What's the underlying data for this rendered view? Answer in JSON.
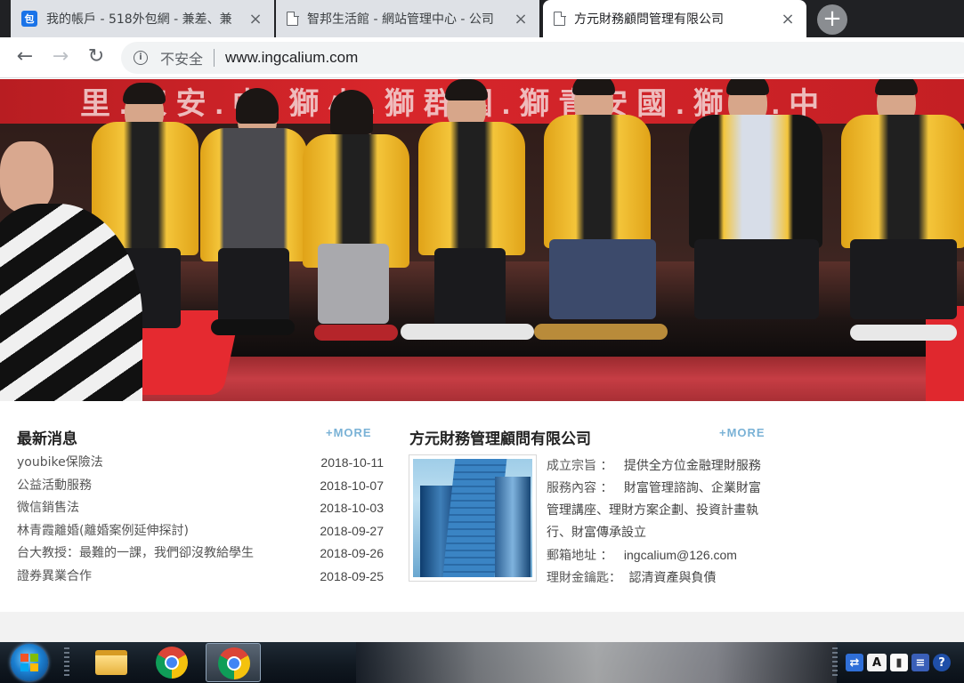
{
  "browser": {
    "tabs": [
      {
        "title": "我的帳戶 - 518外包網 - 兼差、兼",
        "favicon": "518-favicon-icon",
        "active": false
      },
      {
        "title": "智邦生活館 - 網站管理中心 - 公司",
        "favicon": "document-icon",
        "active": false
      },
      {
        "title": "方元財務顧問管理有限公司",
        "favicon": "document-icon",
        "active": true
      }
    ],
    "favicon_label": "包",
    "new_tab_label": "+",
    "toolbar": {
      "back": "←",
      "forward": "→",
      "reload": "↻",
      "security_text": "不安全",
      "url": "www.ingcalium.com"
    }
  },
  "banner": {
    "sign_text": "里.家安.中.獅小.獅群園.獅青安國.獅潭.中"
  },
  "news": {
    "title": "最新消息",
    "more_label": "+MORE",
    "items": [
      {
        "title": "youbike保險法",
        "date": "2018-10-11"
      },
      {
        "title": "公益活動服務",
        "date": "2018-10-07"
      },
      {
        "title": "微信銷售法",
        "date": "2018-10-03"
      },
      {
        "title": "林青霞離婚(離婚案例延伸探討)",
        "date": "2018-09-27"
      },
      {
        "title": "台大教授：最難的一課，我們卻沒教給學生",
        "date": "2018-09-26"
      },
      {
        "title": "證券異業合作",
        "date": "2018-09-25"
      }
    ]
  },
  "company": {
    "title": "方元財務管理顧問有限公司",
    "more_label": "+MORE",
    "info_lines": [
      {
        "label": "成立宗旨 ：",
        "value": "提供全方位金融理財服務"
      },
      {
        "label": "服務內容 ：",
        "value": "財富管理諮詢、企業財富"
      },
      {
        "label": "",
        "value": "管理講座、理財方案企劃、投資計畫執"
      },
      {
        "label": "",
        "value": "行、財富傳承設立"
      },
      {
        "label": "郵箱地址 ：",
        "value": "ingcalium@126.com"
      },
      {
        "label": "理財金鑰匙：",
        "value": "認清資產與負債"
      }
    ]
  },
  "taskbar": {
    "items": [
      "start-orb",
      "file-explorer",
      "chrome",
      "chrome-active"
    ],
    "tray_ime_label": "A"
  }
}
